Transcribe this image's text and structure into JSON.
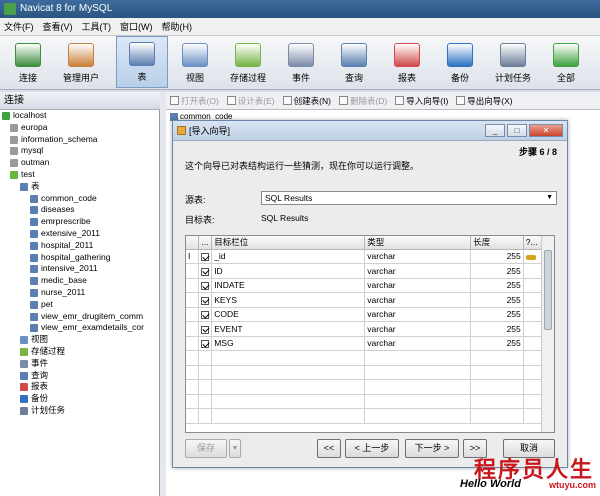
{
  "window": {
    "title": "Navicat 8 for MySQL"
  },
  "menu": [
    "文件(F)",
    "查看(V)",
    "工具(T)",
    "窗口(W)",
    "帮助(H)"
  ],
  "toolbar": [
    {
      "label": "连接",
      "icon": "connection-icon",
      "color": "#3e8e3e"
    },
    {
      "label": "管理用户",
      "icon": "user-icon",
      "color": "#c9803a"
    },
    {
      "label": "表",
      "icon": "table-icon",
      "color": "#5a7fb0",
      "active": true
    },
    {
      "label": "视图",
      "icon": "view-icon",
      "color": "#6b8fc4"
    },
    {
      "label": "存储过程",
      "icon": "procedure-icon",
      "color": "#77b347"
    },
    {
      "label": "事件",
      "icon": "event-icon",
      "color": "#7a8ca8"
    },
    {
      "label": "查询",
      "icon": "query-icon",
      "color": "#5a7fb0"
    },
    {
      "label": "报表",
      "icon": "report-icon",
      "color": "#d04a4a"
    },
    {
      "label": "备份",
      "icon": "backup-icon",
      "color": "#2d73c1"
    },
    {
      "label": "计划任务",
      "icon": "schedule-icon",
      "color": "#6c7f9a"
    },
    {
      "label": "全部",
      "icon": "all-icon",
      "color": "#3fa23f"
    }
  ],
  "tree": {
    "header": "连接",
    "nodes": [
      {
        "label": "localhost",
        "depth": 0,
        "icon": "#3fa23f"
      },
      {
        "label": "europa",
        "depth": 1,
        "icon": "#9a9a9a"
      },
      {
        "label": "information_schema",
        "depth": 1,
        "icon": "#9a9a9a"
      },
      {
        "label": "mysql",
        "depth": 1,
        "icon": "#9a9a9a"
      },
      {
        "label": "outman",
        "depth": 1,
        "icon": "#9a9a9a"
      },
      {
        "label": "test",
        "depth": 1,
        "icon": "#6cb33f"
      },
      {
        "label": "表",
        "depth": 2,
        "icon": "#5a7fb0"
      },
      {
        "label": "common_code",
        "depth": 3,
        "icon": "#5a7fb0"
      },
      {
        "label": "diseases",
        "depth": 3,
        "icon": "#5a7fb0"
      },
      {
        "label": "emrprescribe",
        "depth": 3,
        "icon": "#5a7fb0"
      },
      {
        "label": "extensive_2011",
        "depth": 3,
        "icon": "#5a7fb0"
      },
      {
        "label": "hospital_2011",
        "depth": 3,
        "icon": "#5a7fb0"
      },
      {
        "label": "hospital_gathering",
        "depth": 3,
        "icon": "#5a7fb0"
      },
      {
        "label": "intensive_2011",
        "depth": 3,
        "icon": "#5a7fb0"
      },
      {
        "label": "medic_base",
        "depth": 3,
        "icon": "#5a7fb0"
      },
      {
        "label": "nurse_2011",
        "depth": 3,
        "icon": "#5a7fb0"
      },
      {
        "label": "pet",
        "depth": 3,
        "icon": "#5a7fb0"
      },
      {
        "label": "view_emr_drugitem_comm",
        "depth": 3,
        "icon": "#5a7fb0"
      },
      {
        "label": "view_emr_examdetails_cor",
        "depth": 3,
        "icon": "#5a7fb0"
      },
      {
        "label": "视图",
        "depth": 2,
        "icon": "#6b8fc4"
      },
      {
        "label": "存储过程",
        "depth": 2,
        "icon": "#77b347"
      },
      {
        "label": "事件",
        "depth": 2,
        "icon": "#7a8ca8"
      },
      {
        "label": "查询",
        "depth": 2,
        "icon": "#5a7fb0"
      },
      {
        "label": "报表",
        "depth": 2,
        "icon": "#d04a4a"
      },
      {
        "label": "备份",
        "depth": 2,
        "icon": "#2d73c1"
      },
      {
        "label": "计划任务",
        "depth": 2,
        "icon": "#6c7f9a"
      }
    ]
  },
  "object_toolbar": {
    "open": "打开表(O)",
    "design": "设计表(E)",
    "create": "创建表(N)",
    "delete": "删除表(D)",
    "import": "导入向导(I)",
    "export": "导出向导(X)"
  },
  "list_first_item": "common_code",
  "dialog": {
    "title": "[导入向导]",
    "step": "步骤 6 / 8",
    "description": "这个向导已对表结构运行一些猜测，现在你可以运行调整。",
    "source_label": "源表:",
    "source_value": "SQL Results",
    "target_label": "目标表:",
    "target_value": "SQL Results",
    "grid": {
      "headers": [
        "...",
        "目标栏位",
        "类型",
        "长度",
        "?..."
      ],
      "rows": [
        {
          "name": "_id",
          "type": "varchar",
          "length": "255",
          "key": true,
          "current": true
        },
        {
          "name": "ID",
          "type": "varchar",
          "length": "255",
          "key": false
        },
        {
          "name": "INDATE",
          "type": "varchar",
          "length": "255",
          "key": false
        },
        {
          "name": "KEYS",
          "type": "varchar",
          "length": "255",
          "key": false
        },
        {
          "name": "CODE",
          "type": "varchar",
          "length": "255",
          "key": false
        },
        {
          "name": "EVENT",
          "type": "varchar",
          "length": "255",
          "key": false
        },
        {
          "name": "MSG",
          "type": "varchar",
          "length": "255",
          "key": false
        }
      ]
    },
    "buttons": {
      "save": "保存",
      "first": "<<",
      "prev": "< 上一步",
      "next": "下一步 >",
      "last": ">>",
      "cancel": "取消"
    }
  },
  "watermark": {
    "line1": "程序员人生",
    "line2": "Hello World",
    "line3": "wtuyu.com"
  }
}
